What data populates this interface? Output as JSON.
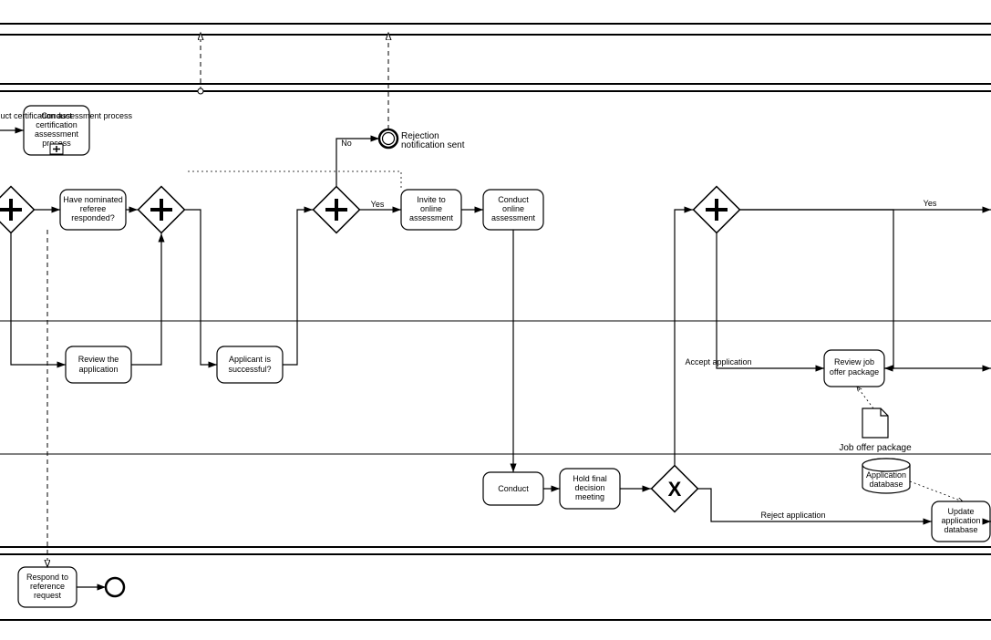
{
  "tasks": {
    "conductCert": "Conduct certification assessment process",
    "haveNominated": "Have nominated referee responded?",
    "reviewApp": "Review the application",
    "applicantSucc": "Applicant is successful?",
    "inviteOnline": "Invite to online assessment",
    "conductOnline": "Conduct online assessment",
    "conduct": "Conduct",
    "holdFinal": "Hold final decision meeting",
    "reviewJob": "Review job offer package",
    "updateDb": "Update application database",
    "respondRef": "Respond to reference request"
  },
  "events": {
    "rejectSent": "Rejection notification sent"
  },
  "labels": {
    "yes": "Yes",
    "no": "No",
    "accept": "Accept application",
    "reject": "Reject application"
  },
  "data": {
    "jobOffer": "Job offer package",
    "appDb": "Application database"
  }
}
